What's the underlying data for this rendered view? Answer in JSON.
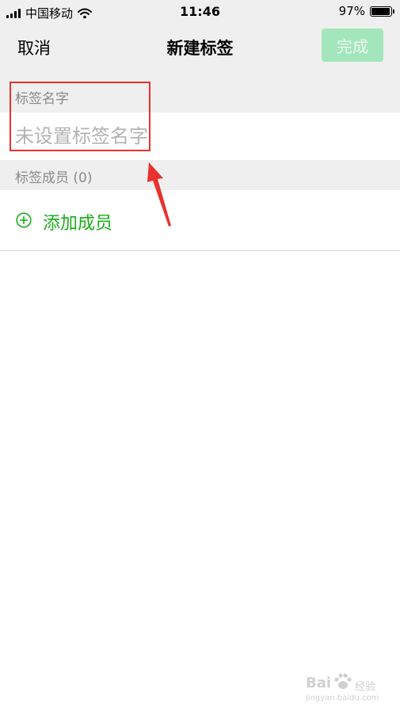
{
  "status_bar": {
    "carrier": "中国移动",
    "time": "11:46",
    "battery_text": "97%",
    "battery_level": 0.97,
    "signal_icon": "signal-bars-icon",
    "wifi_icon": "wifi-icon"
  },
  "nav": {
    "cancel_label": "取消",
    "title": "新建标签",
    "done_label": "完成"
  },
  "tag_name_section": {
    "header": "标签名字",
    "input_value": "",
    "input_placeholder": "未设置标签名字"
  },
  "members_section": {
    "header": "标签成员 (0)",
    "add_label": "添加成员",
    "add_icon": "plus-circle-icon"
  },
  "watermark": {
    "brand": "Bai",
    "suffix": "经验",
    "url": "jingyan.baidu.com"
  },
  "colors": {
    "accent_green": "#1aad19",
    "done_disabled_bg": "#a3e6bb",
    "annotation_red": "#e8322f",
    "section_bg": "#efefef"
  }
}
